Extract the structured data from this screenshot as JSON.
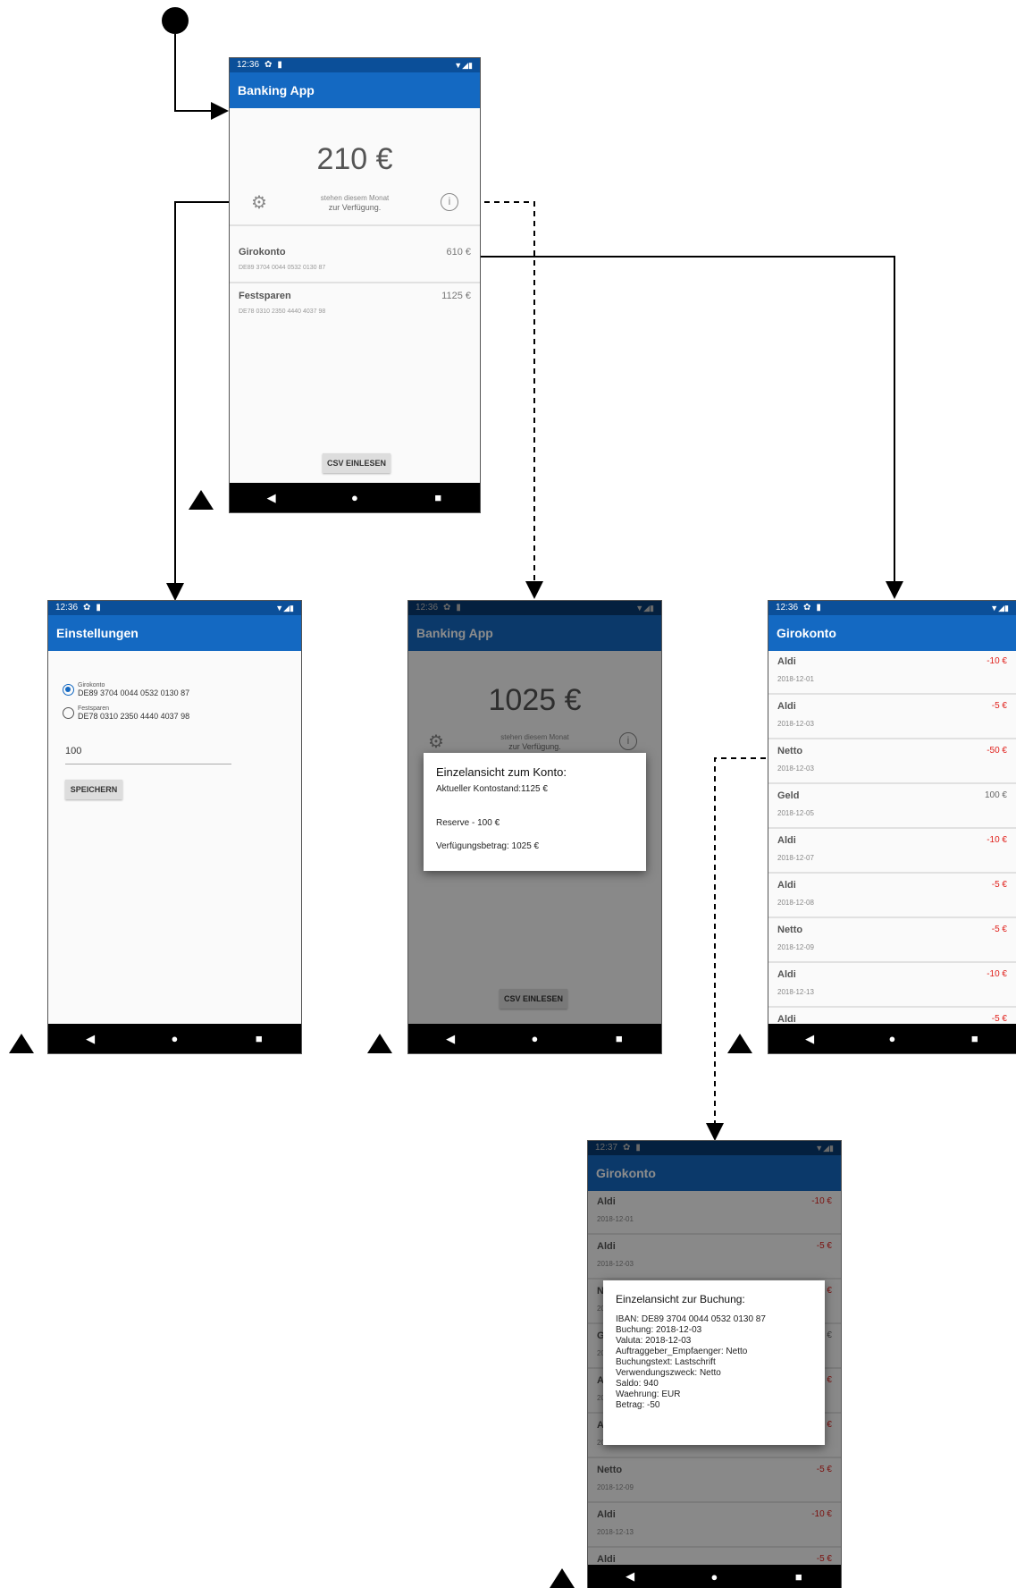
{
  "status_bar": {
    "time_a": "12:36",
    "time_b": "12:37",
    "gear": "✿",
    "card": "▮",
    "signal": "▼◢▮"
  },
  "nav": {
    "back": "◀",
    "home": "●",
    "recent": "■"
  },
  "main": {
    "title": "Banking App",
    "amount": "210 €",
    "subtitle_1": "stehen diesem Monat",
    "subtitle_2": "zur Verfügung.",
    "accounts": [
      {
        "name": "Girokonto",
        "iban": "DE89 3704 0044 0532 0130 87",
        "balance": "610 €"
      },
      {
        "name": "Festsparen",
        "iban": "DE78 0310 2350 4440 4037 98",
        "balance": "1125 €"
      }
    ],
    "csv_button": "CSV EINLESEN"
  },
  "settings": {
    "title": "Einstellungen",
    "options": [
      {
        "label": "Girokonto",
        "iban": "DE89 3704 0044 0532 0130 87",
        "selected": true
      },
      {
        "label": "Festsparen",
        "iban": "DE78 0310 2350 4440 4037 98",
        "selected": false
      }
    ],
    "reserve_value": "100",
    "save_button": "SPEICHERN"
  },
  "account_dialog": {
    "background_amount": "1025 €",
    "title": "Einzelansicht zum Konto:",
    "lines": [
      "Aktueller Kontostand:1125 €",
      "Reserve - 100 €",
      "Verfügungsbetrag: 1025 €"
    ]
  },
  "transactions": {
    "title": "Girokonto",
    "items": [
      {
        "name": "Aldi",
        "date": "2018-12-01",
        "amount": "-10 €"
      },
      {
        "name": "Aldi",
        "date": "2018-12-03",
        "amount": "-5 €"
      },
      {
        "name": "Netto",
        "date": "2018-12-03",
        "amount": "-50 €"
      },
      {
        "name": "Geld",
        "date": "2018-12-05",
        "amount": "100 €"
      },
      {
        "name": "Aldi",
        "date": "2018-12-07",
        "amount": "-10 €"
      },
      {
        "name": "Aldi",
        "date": "2018-12-08",
        "amount": "-5 €"
      },
      {
        "name": "Netto",
        "date": "2018-12-09",
        "amount": "-5 €"
      },
      {
        "name": "Aldi",
        "date": "2018-12-13",
        "amount": "-10 €"
      },
      {
        "name": "Aldi",
        "date": "",
        "amount": "-5 €"
      }
    ]
  },
  "booking_dialog": {
    "title": "Einzelansicht zur Buchung:",
    "lines": [
      "IBAN: DE89 3704 0044 0532 0130 87",
      "Buchung: 2018-12-03",
      "Valuta: 2018-12-03",
      "Auftraggeber_Empfaenger: Netto",
      "Buchungstext: Lastschrift",
      "Verwendungszweck: Netto",
      "Saldo: 940",
      "Waehrung: EUR",
      "Betrag: -50"
    ]
  },
  "colors": {
    "appbar": "#1469c2",
    "statusbar": "#0b4f99",
    "negative": "#e0201b"
  }
}
